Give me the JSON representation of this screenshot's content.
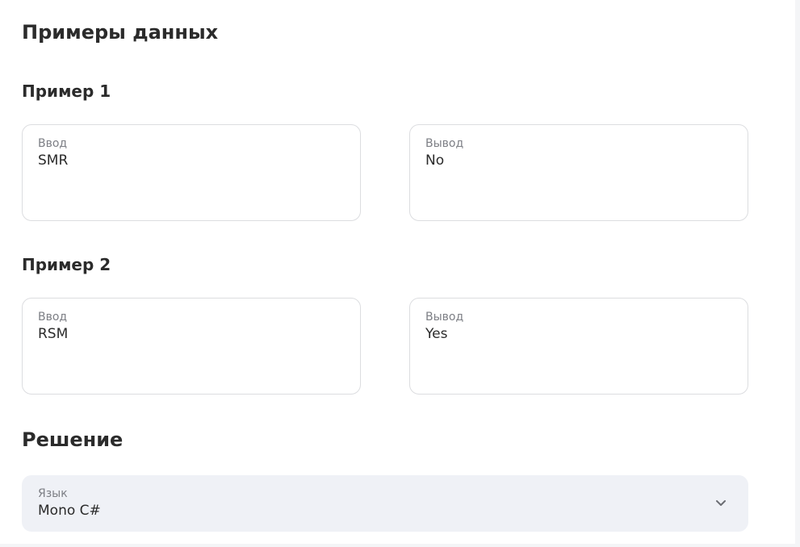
{
  "examples": {
    "title": "Примеры данных",
    "items": [
      {
        "title": "Пример 1",
        "input_label": "Ввод",
        "input_value": "SMR",
        "output_label": "Вывод",
        "output_value": "No"
      },
      {
        "title": "Пример 2",
        "input_label": "Ввод",
        "input_value": "RSM",
        "output_label": "Вывод",
        "output_value": "Yes"
      }
    ]
  },
  "solution": {
    "title": "Решение",
    "language_label": "Язык",
    "language_value": "Mono C#",
    "dropdown_icon": "chevron-down-icon"
  },
  "colors": {
    "text": "#2b2b2b",
    "muted": "#7d7f85",
    "border": "#dcdde0",
    "select_bg": "#eff1f6"
  }
}
